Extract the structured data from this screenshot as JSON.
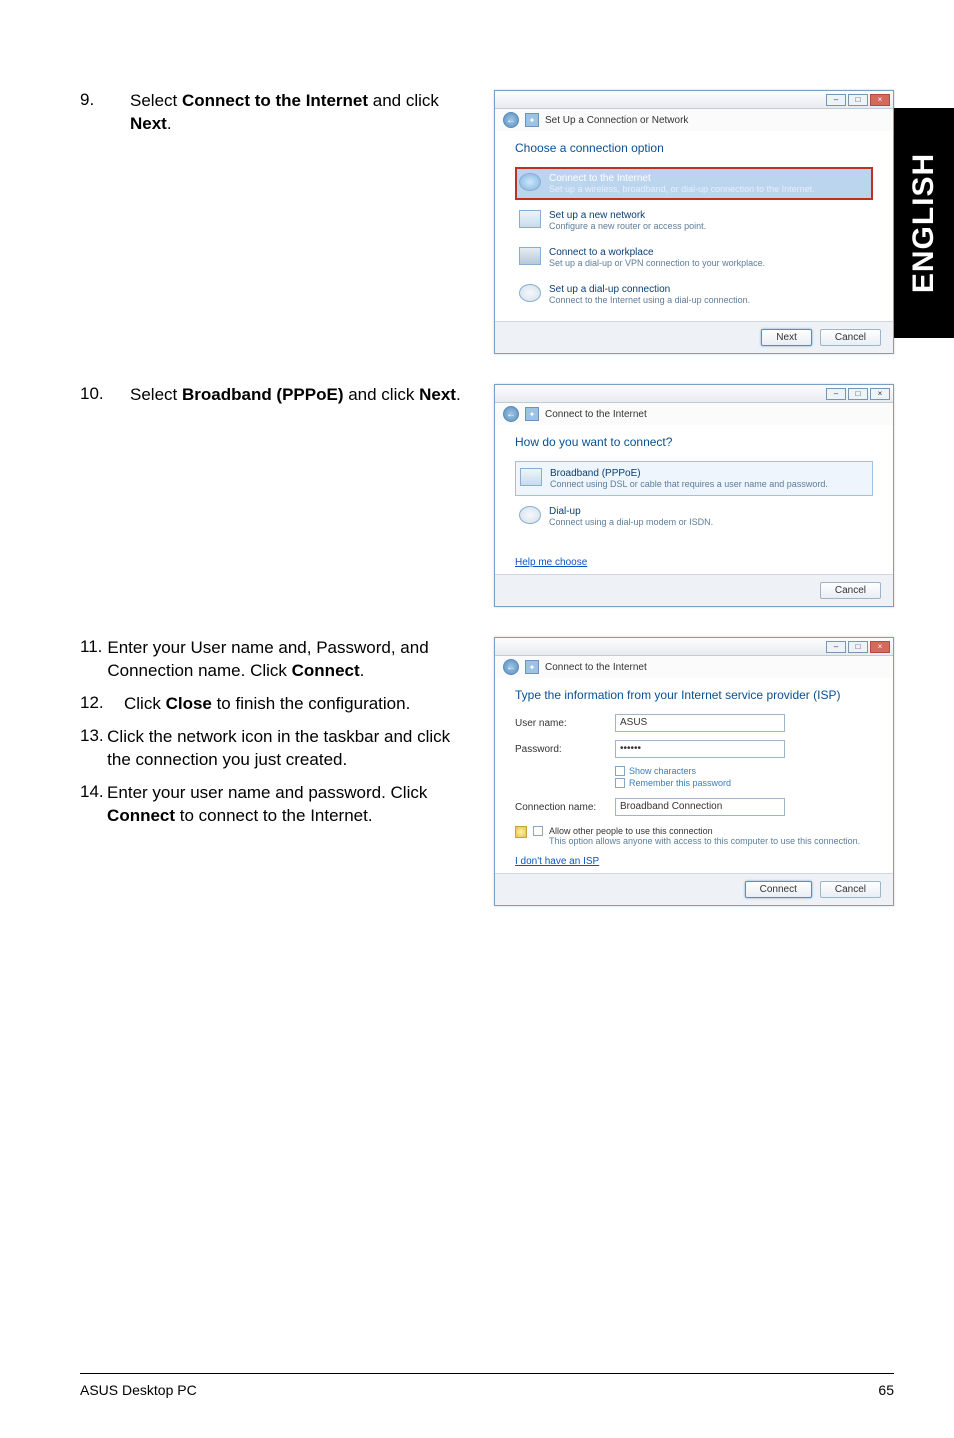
{
  "sideTab": "ENGLISH",
  "step9": {
    "num": "9.",
    "text_a": "Select ",
    "bold_a": "Connect to the Internet",
    "text_b": " and click ",
    "bold_b": "Next",
    "text_c": "."
  },
  "win1": {
    "crumb": "Set Up a Connection or Network",
    "heading": "Choose a connection option",
    "opt1": {
      "title": "Connect to the Internet",
      "sub": "Set up a wireless, broadband, or dial-up connection to the Internet."
    },
    "opt2": {
      "title": "Set up a new network",
      "sub": "Configure a new router or access point."
    },
    "opt3": {
      "title": "Connect to a workplace",
      "sub": "Set up a dial-up or VPN connection to your workplace."
    },
    "opt4": {
      "title": "Set up a dial-up connection",
      "sub": "Connect to the Internet using a dial-up connection."
    },
    "btn_next": "Next",
    "btn_cancel": "Cancel"
  },
  "step10": {
    "num": "10.",
    "text_a": "Select ",
    "bold_a": "Broadband (PPPoE)",
    "text_b": " and click ",
    "bold_b": "Next",
    "text_c": "."
  },
  "win2": {
    "crumb": "Connect to the Internet",
    "heading": "How do you want to connect?",
    "opt1": {
      "title": "Broadband (PPPoE)",
      "sub": "Connect using DSL or cable that requires a user name and password."
    },
    "opt2": {
      "title": "Dial-up",
      "sub": "Connect using a dial-up modem or ISDN."
    },
    "help": "Help me choose",
    "btn_cancel": "Cancel"
  },
  "step11": {
    "num": "11.",
    "text": "Enter your User name and, Password, and Connection name. Click ",
    "bold": "Connect",
    "text2": "."
  },
  "step12": {
    "num": "12.",
    "text": "Click ",
    "bold": "Close",
    "text2": " to finish the configuration."
  },
  "step13": {
    "num": "13.",
    "text": "Click the network icon in the taskbar and click the connection you just created."
  },
  "step14": {
    "num": "14.",
    "text": "Enter your user name and password. Click ",
    "bold": "Connect",
    "text2": " to connect to the Internet."
  },
  "win3": {
    "crumb": "Connect to the Internet",
    "heading": "Type the information from your Internet service provider (ISP)",
    "lbl_user": "User name:",
    "val_user": "ASUS",
    "lbl_pass": "Password:",
    "val_pass": "••••••",
    "chk_show": "Show characters",
    "chk_remember": "Remember this password",
    "lbl_conn": "Connection name:",
    "val_conn": "Broadband Connection",
    "allow_title": "Allow other people to use this connection",
    "allow_sub": "This option allows anyone with access to this computer to use this connection.",
    "noisp": "I don't have an ISP",
    "btn_connect": "Connect",
    "btn_cancel": "Cancel"
  },
  "footer": {
    "left": "ASUS Desktop PC",
    "right": "65"
  }
}
